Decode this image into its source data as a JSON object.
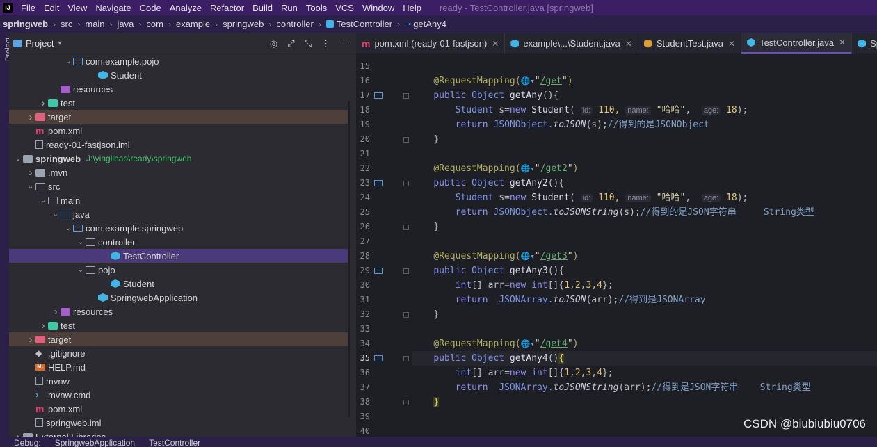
{
  "menubar": {
    "items": [
      "File",
      "Edit",
      "View",
      "Navigate",
      "Code",
      "Analyze",
      "Refactor",
      "Build",
      "Run",
      "Tools",
      "VCS",
      "Window",
      "Help"
    ],
    "window_title": "ready - TestController.java [springweb]"
  },
  "breadcrumbs": [
    "springweb",
    "src",
    "main",
    "java",
    "com",
    "example",
    "springweb",
    "controller",
    "TestController",
    "getAny4"
  ],
  "left_strip": {
    "label": "Project"
  },
  "project": {
    "title": "Project",
    "tree": [
      {
        "label": "com.example.pojo",
        "arrow": "open",
        "icon": "folder-blue",
        "indent": 4
      },
      {
        "label": "Student",
        "arrow": "none",
        "icon": "class",
        "indent": 6
      },
      {
        "label": "resources",
        "arrow": "none",
        "icon": "folder-res",
        "indent": 3
      },
      {
        "label": "test",
        "arrow": "closed",
        "icon": "folder-test",
        "indent": 2
      },
      {
        "label": "target",
        "arrow": "closed",
        "icon": "folder-target",
        "indent": 1,
        "highlight": "target"
      },
      {
        "label": "pom.xml",
        "arrow": "none",
        "icon": "maven",
        "indent": 1
      },
      {
        "label": "ready-01-fastjson.iml",
        "arrow": "none",
        "icon": "iml",
        "indent": 1
      },
      {
        "label": "springweb",
        "path": "J:\\yinglibao\\ready\\springweb",
        "arrow": "open",
        "icon": "folder-dark",
        "indent": 0,
        "bold": true
      },
      {
        "label": ".mvn",
        "arrow": "closed",
        "icon": "folder-dark",
        "indent": 1
      },
      {
        "label": "src",
        "arrow": "open",
        "icon": "folder",
        "indent": 1
      },
      {
        "label": "main",
        "arrow": "open",
        "icon": "folder",
        "indent": 2
      },
      {
        "label": "java",
        "arrow": "open",
        "icon": "folder-blue",
        "indent": 3
      },
      {
        "label": "com.example.springweb",
        "arrow": "open",
        "icon": "folder-blue",
        "indent": 4
      },
      {
        "label": "controller",
        "arrow": "open",
        "icon": "folder",
        "indent": 5
      },
      {
        "label": "TestController",
        "arrow": "none",
        "icon": "class",
        "indent": 7,
        "highlight": "selected"
      },
      {
        "label": "pojo",
        "arrow": "open",
        "icon": "folder",
        "indent": 5
      },
      {
        "label": "Student",
        "arrow": "none",
        "icon": "class",
        "indent": 7
      },
      {
        "label": "SpringwebApplication",
        "arrow": "none",
        "icon": "class",
        "indent": 6
      },
      {
        "label": "resources",
        "arrow": "closed",
        "icon": "folder-res",
        "indent": 3
      },
      {
        "label": "test",
        "arrow": "closed",
        "icon": "folder-test",
        "indent": 2
      },
      {
        "label": "target",
        "arrow": "closed",
        "icon": "folder-target",
        "indent": 1,
        "highlight": "target"
      },
      {
        "label": ".gitignore",
        "arrow": "none",
        "icon": "git",
        "indent": 1
      },
      {
        "label": "HELP.md",
        "arrow": "none",
        "icon": "md",
        "indent": 1
      },
      {
        "label": "mvnw",
        "arrow": "none",
        "icon": "iml",
        "indent": 1
      },
      {
        "label": "mvnw.cmd",
        "arrow": "none",
        "icon": "cmd",
        "indent": 1
      },
      {
        "label": "pom.xml",
        "arrow": "none",
        "icon": "maven",
        "indent": 1
      },
      {
        "label": "springweb.iml",
        "arrow": "none",
        "icon": "iml",
        "indent": 1
      },
      {
        "label": "External Libraries",
        "arrow": "closed",
        "icon": "folder-dark",
        "indent": 0
      }
    ]
  },
  "tabs": [
    {
      "label": "pom.xml (ready-01-fastjson)",
      "icon": "maven"
    },
    {
      "label": "example\\...\\Student.java",
      "icon": "class"
    },
    {
      "label": "StudentTest.java",
      "icon": "test"
    },
    {
      "label": "TestController.java",
      "icon": "class",
      "active": true
    },
    {
      "label": "Sp",
      "icon": "class"
    }
  ],
  "editor": {
    "current_line": 35,
    "lines": [
      {
        "n": 15,
        "tokens": []
      },
      {
        "n": 16,
        "tokens": [
          [
            "    ",
            ""
          ],
          [
            "@RequestMapping(",
            "ann"
          ],
          [
            "🌐",
            "globe"
          ],
          [
            "▾",
            "globe"
          ],
          [
            "\"",
            "str2"
          ],
          [
            "/get",
            "str"
          ],
          [
            "\"",
            "str2"
          ],
          [
            ")",
            "ann"
          ]
        ]
      },
      {
        "n": 17,
        "mark": true,
        "fold": true,
        "tokens": [
          [
            "    ",
            ""
          ],
          [
            "public ",
            "kw"
          ],
          [
            "Object ",
            "type"
          ],
          [
            "getAny",
            "fn"
          ],
          [
            "(){",
            ""
          ]
        ]
      },
      {
        "n": 18,
        "tokens": [
          [
            "        ",
            ""
          ],
          [
            "Student ",
            "type"
          ],
          [
            "s=",
            ""
          ],
          [
            "new ",
            "kw"
          ],
          [
            "Student",
            "fn"
          ],
          [
            "( ",
            ""
          ],
          [
            "id:",
            "hint"
          ],
          [
            " 110, ",
            "num"
          ],
          [
            "name:",
            "hint"
          ],
          [
            " \"哈哈\"",
            "str2"
          ],
          [
            ",  ",
            ""
          ],
          [
            "age:",
            "hint"
          ],
          [
            " 18",
            "num"
          ],
          [
            ");",
            ""
          ]
        ]
      },
      {
        "n": 19,
        "tokens": [
          [
            "        ",
            ""
          ],
          [
            "return ",
            "kw"
          ],
          [
            "JSONObject.",
            "type"
          ],
          [
            "toJSON",
            "it"
          ],
          [
            "(s);",
            ""
          ],
          [
            "//得到的是JSONObject",
            "cm"
          ]
        ]
      },
      {
        "n": 20,
        "fold": true,
        "tokens": [
          [
            "    ",
            ""
          ],
          [
            "}",
            ""
          ]
        ]
      },
      {
        "n": 21,
        "tokens": []
      },
      {
        "n": 22,
        "tokens": [
          [
            "    ",
            ""
          ],
          [
            "@RequestMapping(",
            "ann"
          ],
          [
            "🌐",
            "globe"
          ],
          [
            "▾",
            "globe"
          ],
          [
            "\"",
            "str2"
          ],
          [
            "/get2",
            "str"
          ],
          [
            "\"",
            "str2"
          ],
          [
            ")",
            "ann"
          ]
        ]
      },
      {
        "n": 23,
        "mark": true,
        "fold": true,
        "tokens": [
          [
            "    ",
            ""
          ],
          [
            "public ",
            "kw"
          ],
          [
            "Object ",
            "type"
          ],
          [
            "getAny2",
            "fn"
          ],
          [
            "(){",
            ""
          ]
        ]
      },
      {
        "n": 24,
        "tokens": [
          [
            "        ",
            ""
          ],
          [
            "Student ",
            "type"
          ],
          [
            "s=",
            ""
          ],
          [
            "new ",
            "kw"
          ],
          [
            "Student",
            "fn"
          ],
          [
            "( ",
            ""
          ],
          [
            "id:",
            "hint"
          ],
          [
            " 110, ",
            "num"
          ],
          [
            "name:",
            "hint"
          ],
          [
            " \"哈哈\"",
            "str2"
          ],
          [
            ",  ",
            ""
          ],
          [
            "age:",
            "hint"
          ],
          [
            " 18",
            "num"
          ],
          [
            ");",
            ""
          ]
        ]
      },
      {
        "n": 25,
        "tokens": [
          [
            "        ",
            ""
          ],
          [
            "return ",
            "kw"
          ],
          [
            "JSONObject.",
            "type"
          ],
          [
            "toJSONString",
            "it"
          ],
          [
            "(s);",
            ""
          ],
          [
            "//得到的是JSON字符串     String类型",
            "cm"
          ]
        ]
      },
      {
        "n": 26,
        "fold": true,
        "tokens": [
          [
            "    ",
            ""
          ],
          [
            "}",
            ""
          ]
        ]
      },
      {
        "n": 27,
        "tokens": []
      },
      {
        "n": 28,
        "tokens": [
          [
            "    ",
            ""
          ],
          [
            "@RequestMapping(",
            "ann"
          ],
          [
            "🌐",
            "globe"
          ],
          [
            "▾",
            "globe"
          ],
          [
            "\"",
            "str2"
          ],
          [
            "/get3",
            "str"
          ],
          [
            "\"",
            "str2"
          ],
          [
            ")",
            "ann"
          ]
        ]
      },
      {
        "n": 29,
        "mark": true,
        "fold": true,
        "tokens": [
          [
            "    ",
            ""
          ],
          [
            "public ",
            "kw"
          ],
          [
            "Object ",
            "type"
          ],
          [
            "getAny3",
            "fn"
          ],
          [
            "(){",
            ""
          ]
        ]
      },
      {
        "n": 30,
        "tokens": [
          [
            "        ",
            ""
          ],
          [
            "int",
            "kw"
          ],
          [
            "[] arr=",
            ""
          ],
          [
            "new ",
            "kw"
          ],
          [
            "int",
            "kw"
          ],
          [
            "[]{",
            ""
          ],
          [
            "1",
            "num"
          ],
          [
            ",",
            ""
          ],
          [
            "2",
            "num"
          ],
          [
            ",",
            ""
          ],
          [
            "3",
            "num"
          ],
          [
            ",",
            ""
          ],
          [
            "4",
            "num"
          ],
          [
            "};",
            ""
          ]
        ]
      },
      {
        "n": 31,
        "tokens": [
          [
            "        ",
            ""
          ],
          [
            "return  ",
            "kw"
          ],
          [
            "JSONArray.",
            "type"
          ],
          [
            "toJSON",
            "it"
          ],
          [
            "(arr);",
            ""
          ],
          [
            "//得到是JSONArray",
            "cm"
          ]
        ]
      },
      {
        "n": 32,
        "fold": true,
        "tokens": [
          [
            "    ",
            ""
          ],
          [
            "}",
            ""
          ]
        ]
      },
      {
        "n": 33,
        "tokens": []
      },
      {
        "n": 34,
        "tokens": [
          [
            "    ",
            ""
          ],
          [
            "@RequestMapping(",
            "ann"
          ],
          [
            "🌐",
            "globe"
          ],
          [
            "▾",
            "globe"
          ],
          [
            "\"",
            "str2"
          ],
          [
            "/get4",
            "str"
          ],
          [
            "\"",
            "str2"
          ],
          [
            ")",
            "ann"
          ]
        ]
      },
      {
        "n": 35,
        "mark": true,
        "fold": true,
        "tokens": [
          [
            "    ",
            ""
          ],
          [
            "public ",
            "kw"
          ],
          [
            "Object ",
            "type"
          ],
          [
            "getAny4",
            "fn"
          ],
          [
            "()",
            ""
          ],
          [
            "{",
            "match"
          ]
        ]
      },
      {
        "n": 36,
        "tokens": [
          [
            "        ",
            ""
          ],
          [
            "int",
            "kw"
          ],
          [
            "[] arr=",
            ""
          ],
          [
            "new ",
            "kw"
          ],
          [
            "int",
            "kw"
          ],
          [
            "[]{",
            ""
          ],
          [
            "1",
            "num"
          ],
          [
            ",",
            ""
          ],
          [
            "2",
            "num"
          ],
          [
            ",",
            ""
          ],
          [
            "3",
            "num"
          ],
          [
            ",",
            ""
          ],
          [
            "4",
            "num"
          ],
          [
            "};",
            ""
          ]
        ]
      },
      {
        "n": 37,
        "tokens": [
          [
            "        ",
            ""
          ],
          [
            "return  ",
            "kw"
          ],
          [
            "JSONArray.",
            "type"
          ],
          [
            "toJSONString",
            "it"
          ],
          [
            "(arr);",
            ""
          ],
          [
            "//得到是JSON字符串    String类型",
            "cm"
          ]
        ]
      },
      {
        "n": 38,
        "fold": true,
        "tokens": [
          [
            "    ",
            ""
          ],
          [
            "}",
            "match"
          ]
        ]
      },
      {
        "n": 39,
        "tokens": []
      },
      {
        "n": 40,
        "tokens": []
      }
    ]
  },
  "watermark": "CSDN @biubiubiu0706",
  "bottombar": {
    "debug_label": "Debug:",
    "items": [
      "SpringwebApplication",
      "TestController"
    ]
  }
}
